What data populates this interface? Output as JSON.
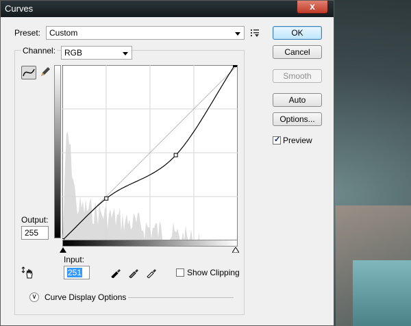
{
  "window": {
    "title": "Curves",
    "close_label": "x"
  },
  "preset": {
    "label": "Preset:",
    "value": "Custom"
  },
  "channel": {
    "label": "Channel:",
    "value": "RGB"
  },
  "buttons": {
    "ok": "OK",
    "cancel": "Cancel",
    "smooth": "Smooth",
    "auto": "Auto",
    "options": "Options..."
  },
  "preview": {
    "label": "Preview",
    "checked": true
  },
  "output": {
    "label": "Output:",
    "value": "255"
  },
  "input": {
    "label": "Input:",
    "value": "251"
  },
  "show_clipping": {
    "label": "Show Clipping",
    "checked": false
  },
  "curve_display": {
    "label": "Curve Display Options"
  },
  "curve": {
    "points": [
      [
        0,
        0
      ],
      [
        64,
        61
      ],
      [
        165,
        124
      ],
      [
        251,
        255
      ]
    ],
    "grid_divisions": 4
  },
  "icons": {
    "curve_tool": "curve-point-icon",
    "pencil_tool": "pencil-icon",
    "preset_menu": "preset-options-icon",
    "hand_tool": "target-adjust-icon",
    "black_eyedropper": "black-eyedropper-icon",
    "gray_eyedropper": "gray-eyedropper-icon",
    "white_eyedropper": "white-eyedropper-icon"
  }
}
